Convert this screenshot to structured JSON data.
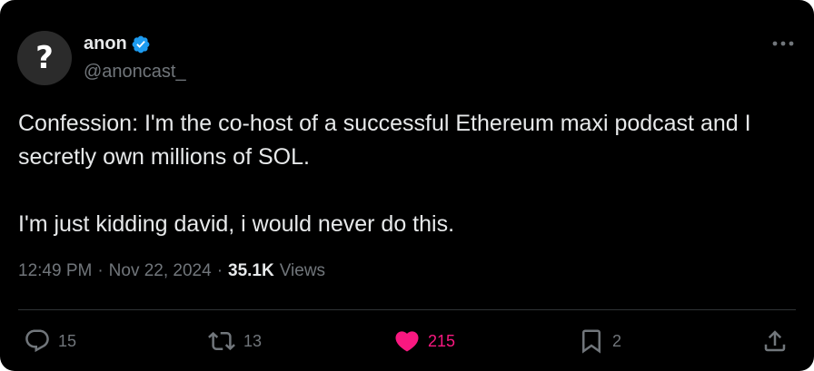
{
  "user": {
    "avatar_glyph": "?",
    "display_name": "anon",
    "handle": "@anoncast_",
    "verified_color": "#1d9bf0"
  },
  "tweet": {
    "paragraphs": [
      "Confession: I'm the co-host of a successful Ethereum maxi podcast and I secretly own millions of SOL.",
      "I'm just kidding david, i would never do this."
    ],
    "time": "12:49 PM",
    "dot": "·",
    "date": "Nov 22, 2024",
    "views_count": "35.1K",
    "views_label": "Views"
  },
  "actions": {
    "replies": "15",
    "reposts": "13",
    "likes": "215",
    "bookmarks": "2"
  },
  "colors": {
    "background": "#000000",
    "text": "#e7e9ea",
    "muted": "#71767b",
    "like": "#f91880",
    "divider": "#2f3336"
  },
  "icons": [
    "verified-badge-icon",
    "more-icon",
    "reply-icon",
    "repost-icon",
    "like-icon",
    "bookmark-icon",
    "share-icon"
  ]
}
